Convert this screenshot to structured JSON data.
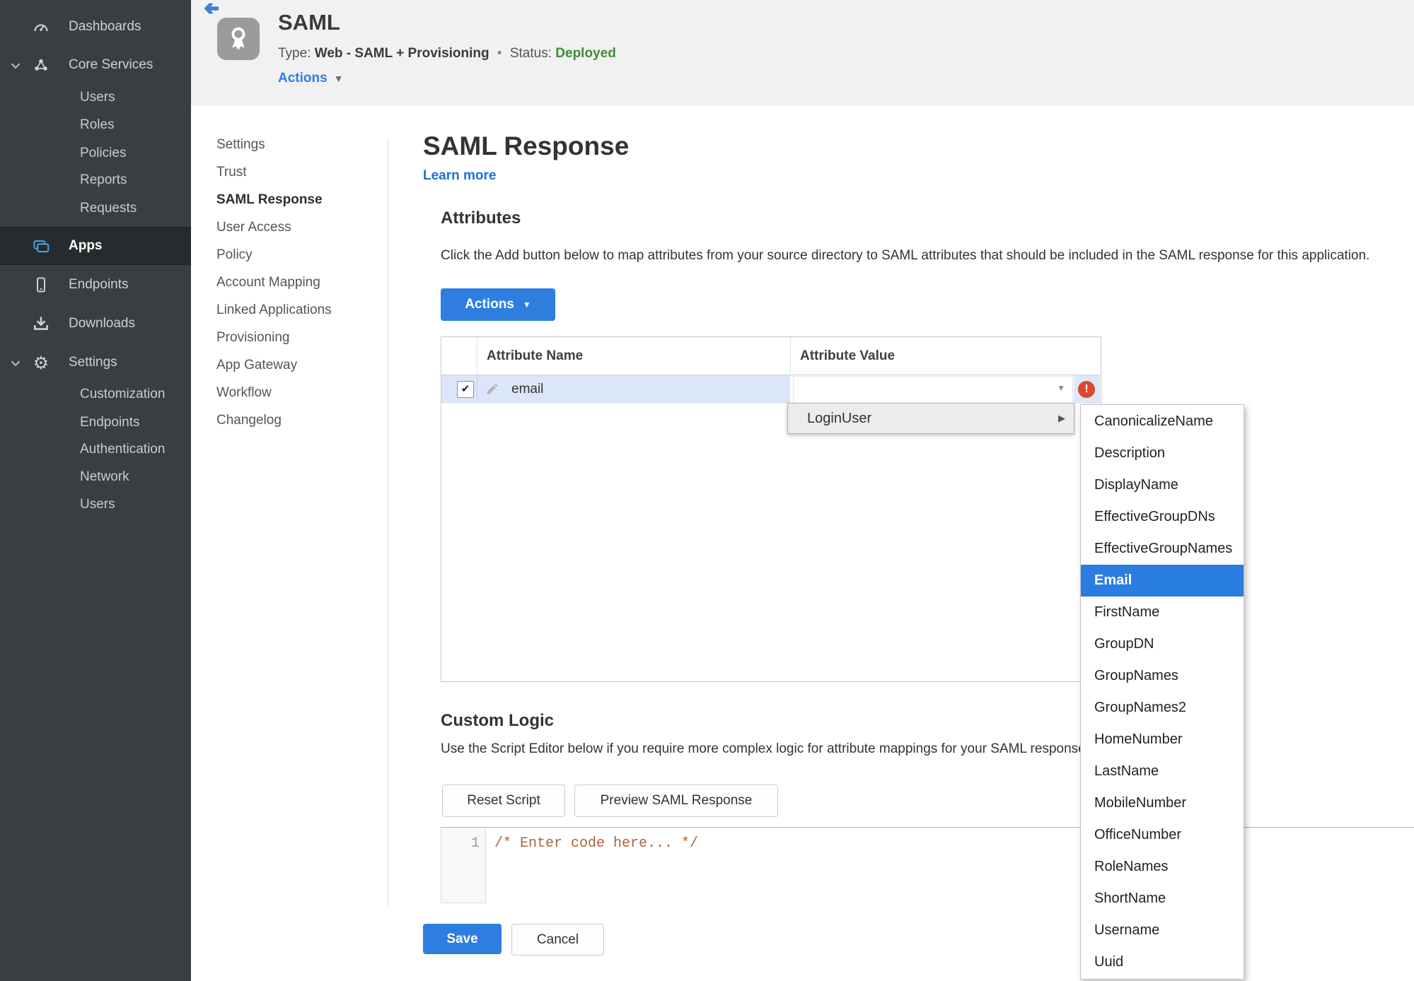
{
  "colors": {
    "accent": "#2e7ee0",
    "link": "#1d6fdc",
    "status_green": "#3d8e33",
    "error_red": "#d9492f",
    "row_highlight": "#dbe7f8",
    "menu_selected": "#2a7ce0",
    "sidebar_bg": "#3a3e41",
    "sidebar_active_bg": "#282b2d",
    "header_bg": "#f1f1f2",
    "code_comment": "#a9653a",
    "app_icon_blue": "#3ea2e5"
  },
  "glyphs": {
    "caret_down": "▼",
    "submenu_arrow": "▶",
    "check": "✔",
    "error_mark": "!",
    "dot": "•",
    "gear": "⚙"
  },
  "sidebar": {
    "dashboards": "Dashboards",
    "core_services": "Core Services",
    "core_children": [
      "Users",
      "Roles",
      "Policies",
      "Reports",
      "Requests"
    ],
    "apps": "Apps",
    "endpoints": "Endpoints",
    "downloads": "Downloads",
    "settings": "Settings",
    "settings_children": [
      "Customization",
      "Endpoints",
      "Authentication",
      "Network",
      "Users"
    ]
  },
  "header": {
    "app_name": "SAML",
    "type_label": "Type:",
    "type_value": "Web - SAML + Provisioning",
    "status_label": "Status:",
    "status_value": "Deployed",
    "actions_label": "Actions"
  },
  "subnav": {
    "items": [
      "Settings",
      "Trust",
      "SAML Response",
      "User Access",
      "Policy",
      "Account Mapping",
      "Linked Applications",
      "Provisioning",
      "App Gateway",
      "Workflow",
      "Changelog"
    ],
    "active": "SAML Response"
  },
  "main": {
    "title": "SAML Response",
    "learn_more": "Learn more",
    "attributes": {
      "heading": "Attributes",
      "description": "Click the Add button below to map attributes from your source directory to SAML attributes that should be included in the SAML response for this application.",
      "actions_button": "Actions"
    },
    "table": {
      "col_name": "Attribute Name",
      "col_value": "Attribute Value",
      "row_name": "email",
      "row_value": ""
    },
    "value_menu": {
      "parent": "LoginUser",
      "selected": "Email",
      "items": [
        "CanonicalizeName",
        "Description",
        "DisplayName",
        "EffectiveGroupDNs",
        "EffectiveGroupNames",
        "Email",
        "FirstName",
        "GroupDN",
        "GroupNames",
        "GroupNames2",
        "HomeNumber",
        "LastName",
        "MobileNumber",
        "OfficeNumber",
        "RoleNames",
        "ShortName",
        "Username",
        "Uuid"
      ]
    },
    "custom_logic": {
      "heading": "Custom Logic",
      "description": "Use the Script Editor below if you require more complex logic for attribute mappings for your SAML response.",
      "reset_button": "Reset Script",
      "preview_button": "Preview SAML Response"
    },
    "editor": {
      "line_number": "1",
      "code": "/* Enter code here... */"
    },
    "footer": {
      "save": "Save",
      "cancel": "Cancel"
    }
  }
}
